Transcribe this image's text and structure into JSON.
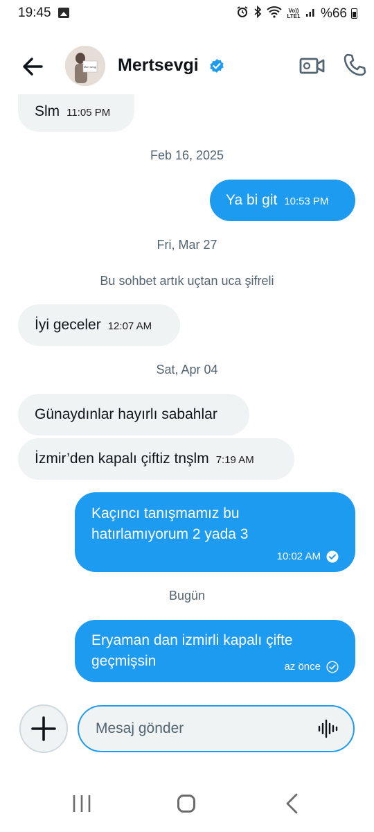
{
  "status_bar": {
    "time": "19:45",
    "battery": "%66",
    "volte": "Vo)) LTE1"
  },
  "header": {
    "name": "Mertsevgi",
    "avatar_caption": "Mert sevgi"
  },
  "messages": [
    {
      "direction": "in",
      "text": "Slm",
      "time": "11:05 PM"
    },
    {
      "separator": "Feb 16, 2025"
    },
    {
      "direction": "out",
      "text": "Ya bi git",
      "time": "10:53 PM"
    },
    {
      "separator": "Fri, Mar 27"
    },
    {
      "notice": "Bu sohbet artık uçtan uca şifreli"
    },
    {
      "direction": "in",
      "text": "İyi geceler",
      "time": "12:07 AM"
    },
    {
      "separator": "Sat, Apr 04"
    },
    {
      "direction": "in",
      "text": "Günaydınlar hayırlı sabahlar",
      "time": ""
    },
    {
      "direction": "in",
      "text": "İzmir’den kapalı çiftiz tnşlm",
      "time": "7:19 AM"
    },
    {
      "direction": "out",
      "text": "Kaçıncı tanışmamız bu hatırlamıyorum 2 yada 3",
      "time": "10:02 AM",
      "status": "read"
    },
    {
      "separator": "Bugün"
    },
    {
      "direction": "out",
      "text": "Eryaman dan izmirli  kapalı çifte geçmişsin",
      "time": "az önce",
      "status": "sent"
    }
  ],
  "composer": {
    "placeholder": "Mesaj gönder"
  },
  "colors": {
    "accent": "#1d9bf0",
    "incoming_bubble": "#eff3f4",
    "muted_text": "#536471"
  },
  "icons": {
    "back": "arrow-left-icon",
    "verified": "verified-badge-icon",
    "video": "video-camera-icon",
    "call": "phone-icon",
    "add": "plus-icon",
    "voice": "waveform-icon"
  }
}
